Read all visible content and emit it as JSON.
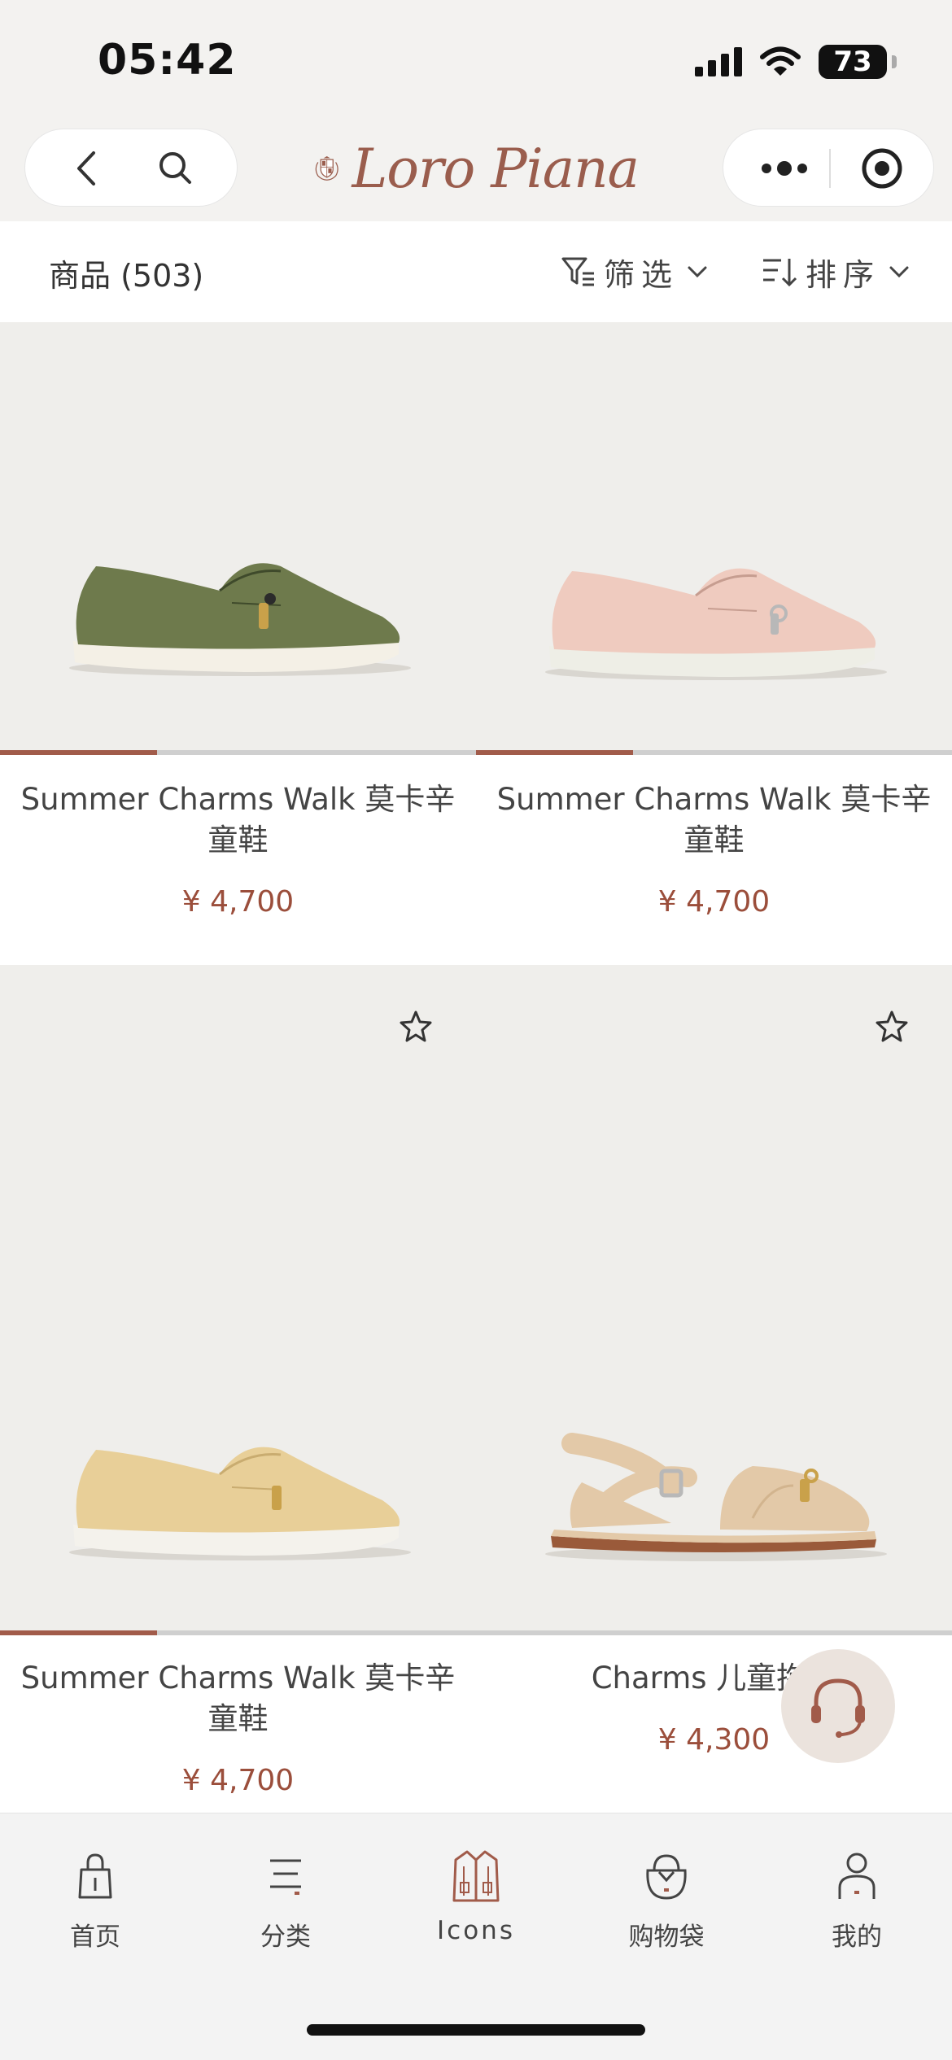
{
  "status_bar": {
    "time": "05:42",
    "battery": "73"
  },
  "header": {
    "brand_logo_text": "Loro Piana"
  },
  "filter_bar": {
    "product_count": "商品 (503)",
    "filter_label": "筛选",
    "sort_label": "排序"
  },
  "colors": {
    "accent": "#a15b4a",
    "price": "#9b4e3b"
  },
  "products": [
    {
      "name": "Summer Charms Walk 莫卡辛童鞋",
      "price": "¥ 4,700",
      "shoe_color": "#6e7a4c",
      "image_progress": 0.33
    },
    {
      "name": "Summer Charms Walk 莫卡辛童鞋",
      "price": "¥ 4,700",
      "shoe_color": "#efcbbf",
      "image_progress": 0.33
    },
    {
      "name": "Summer Charms Walk 莫卡辛童鞋",
      "price": "¥ 4,700",
      "shoe_color": "#e8cf98",
      "image_progress": 0.33
    },
    {
      "name": "Charms 儿童拖鞋",
      "price": "¥ 4,300",
      "shoe_color": "#e3c9a8",
      "image_progress": 0
    }
  ],
  "tabs": [
    {
      "label": "首页",
      "icon": "home-bag-icon"
    },
    {
      "label": "分类",
      "icon": "category-list-icon"
    },
    {
      "label": "Icons",
      "icon": "jacket-icon"
    },
    {
      "label": "购物袋",
      "icon": "shopping-bag-icon"
    },
    {
      "label": "我的",
      "icon": "profile-icon"
    }
  ]
}
